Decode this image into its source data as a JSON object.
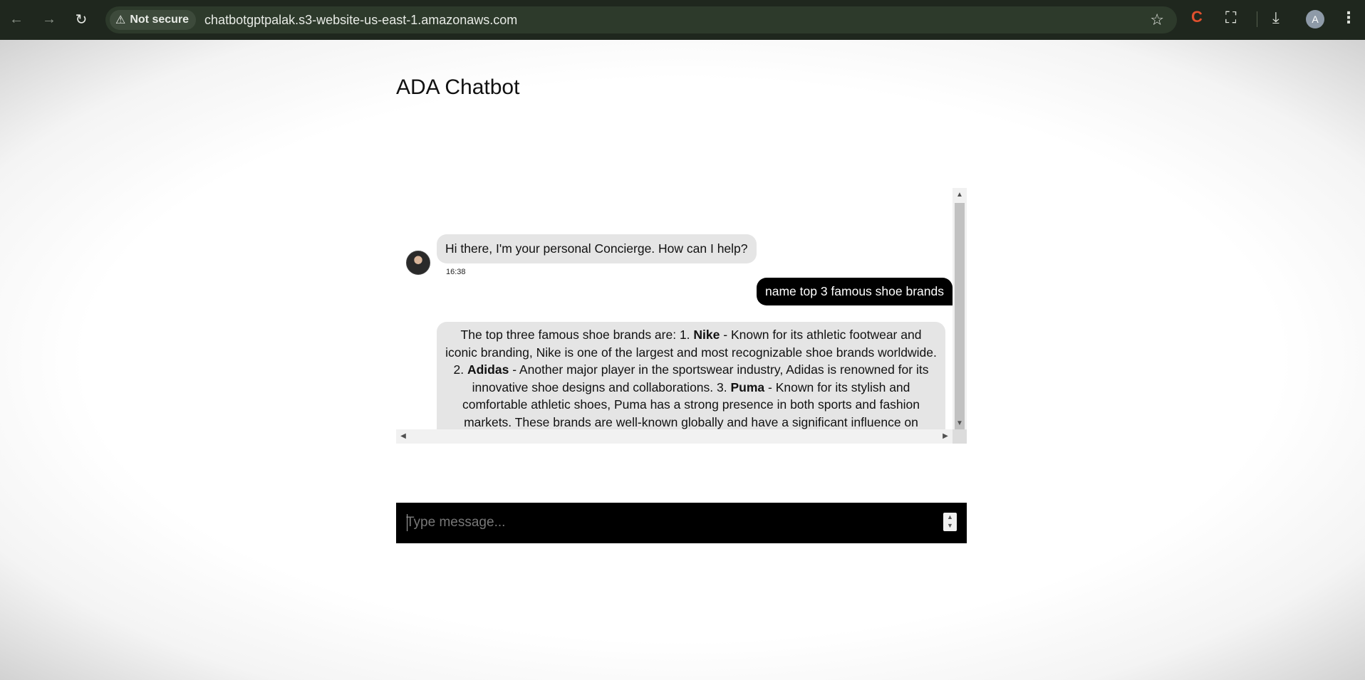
{
  "browser": {
    "security_label": "Not secure",
    "url": "chatbotgptpalak.s3-website-us-east-1.amazonaws.com",
    "profile_initial": "A",
    "extension_label": "C"
  },
  "page": {
    "title": "ADA Chatbot"
  },
  "chat": {
    "greeting": "Hi there, I'm your personal Concierge. How can I help?",
    "greeting_time": "16:38",
    "user_message": "name top 3 famous shoe brands",
    "reply": {
      "intro": "The top three famous shoe brands are: 1. ",
      "brand1": "Nike",
      "text1": " - Known for its athletic footwear and iconic branding, Nike is one of the largest and most recognizable shoe brands worldwide. 2. ",
      "brand2": "Adidas",
      "text2": " - Another major player in the sportswear industry, Adidas is renowned for its innovative shoe designs and collaborations. 3. ",
      "brand3": "Puma",
      "text3": " - Known for its stylish and comfortable athletic shoes, Puma has a strong presence in both sports and fashion markets. These brands are well-known globally and have a significant influence on sports and lifestyle footwear trends."
    }
  },
  "composer": {
    "placeholder": "Type message..."
  },
  "icons": {
    "back": "back-arrow-icon",
    "forward": "forward-arrow-icon",
    "reload": "reload-icon",
    "warning": "warning-icon",
    "bookmark": "star-icon",
    "extensions": "puzzle-icon",
    "downloads": "download-icon",
    "menu": "kebab-menu-icon"
  }
}
